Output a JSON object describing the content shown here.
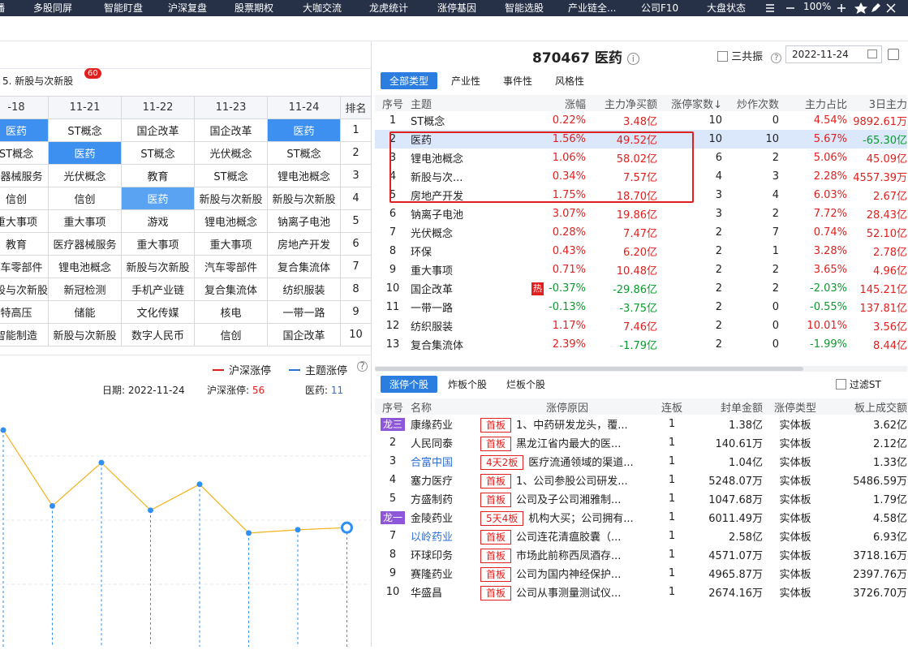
{
  "nav": {
    "items": [
      "播",
      "多股同屏",
      "智能盯盘",
      "沪深复盘",
      "股票期权",
      "大咖交流",
      "龙虎统计",
      "涨停基因",
      "智能选股",
      "产业链全...",
      "公司F10",
      "大盘状态"
    ],
    "zoom": "100%",
    "controls": [
      "menu-icon",
      "minus-icon",
      "plus-icon",
      "star-icon",
      "edit-icon",
      "close-icon"
    ]
  },
  "left": {
    "section_title": "5. 新股与次新股",
    "section_badge": "60",
    "rank_table": {
      "headers": [
        "-18",
        "11-21",
        "11-22",
        "11-23",
        "11-24",
        "排名"
      ],
      "rows": [
        [
          "医药",
          "ST概念",
          "国企改革",
          "国企改革",
          "医药",
          "1"
        ],
        [
          "ST概念",
          "医药",
          "ST概念",
          "光伏概念",
          "ST概念",
          "2"
        ],
        [
          "疗器械服务",
          "光伏概念",
          "教育",
          "ST概念",
          "锂电池概念",
          "3"
        ],
        [
          "信创",
          "信创",
          "医药",
          "新股与次新股",
          "新股与次新股",
          "4"
        ],
        [
          "重大事项",
          "重大事项",
          "游戏",
          "锂电池概念",
          "钠离子电池",
          "5"
        ],
        [
          "教育",
          "医疗器械服务",
          "重大事项",
          "重大事项",
          "房地产开发",
          "6"
        ],
        [
          "汽车零部件",
          "锂电池概念",
          "新股与次新股",
          "汽车零部件",
          "复合集流体",
          "7"
        ],
        [
          "新股与次新股",
          "新冠检测",
          "手机产业链",
          "复合集流体",
          "纺织服装",
          "8"
        ],
        [
          "特高压",
          "储能",
          "文化传媒",
          "核电",
          "一带一路",
          "9"
        ],
        [
          "智能制造",
          "新股与次新股",
          "数字人民币",
          "信创",
          "国企改革",
          "10"
        ]
      ]
    },
    "legend": {
      "series1": "沪深涨停",
      "series2": "主题涨停"
    },
    "info": {
      "date_label": "日期:",
      "date": "2022-11-24",
      "hs_label": "沪深涨停:",
      "hs_value": "56",
      "theme_label": "医药:",
      "theme_value": "11"
    },
    "chart_data": {
      "type": "line",
      "series": [
        {
          "name": "主题涨停",
          "values": [
            20,
            13,
            17,
            12.6,
            15,
            10.5,
            10.8,
            11
          ]
        }
      ],
      "ylim": [
        0,
        23
      ],
      "colors": {
        "line": "#f2b21a",
        "highlight": "#2f8ff5"
      }
    }
  },
  "right": {
    "stock_code": "870467",
    "stock_name": "医药",
    "sanfen_label": "三共振",
    "date_value": "2022-11-24",
    "top_tabs": [
      "全部类型",
      "产业性",
      "事件性",
      "风格性"
    ],
    "top_headers": [
      "序号",
      "主题",
      "涨幅",
      "主力净买额",
      "涨停家数↓",
      "炒作次数",
      "主力占比",
      "3日主力"
    ],
    "top_rows": [
      {
        "no": "1",
        "name": "ST概念",
        "chg": "0.22%",
        "net": "3.48亿",
        "zt": "10",
        "cz": "0",
        "ratio": "4.54%",
        "d3": "9892.61万",
        "sel": false,
        "hot": false
      },
      {
        "no": "2",
        "name": "医药",
        "chg": "1.56%",
        "net": "49.52亿",
        "zt": "10",
        "cz": "10",
        "ratio": "5.67%",
        "d3": "-65.30亿",
        "sel": true,
        "hot": false
      },
      {
        "no": "3",
        "name": "锂电池概念",
        "chg": "1.06%",
        "net": "58.02亿",
        "zt": "6",
        "cz": "2",
        "ratio": "5.06%",
        "d3": "45.09亿",
        "sel": false,
        "hot": false
      },
      {
        "no": "4",
        "name": "新股与次...",
        "chg": "0.34%",
        "net": "7.57亿",
        "zt": "4",
        "cz": "3",
        "ratio": "2.28%",
        "d3": "4557.39万",
        "sel": false,
        "hot": false
      },
      {
        "no": "5",
        "name": "房地产开发",
        "chg": "1.75%",
        "net": "18.70亿",
        "zt": "3",
        "cz": "4",
        "ratio": "6.03%",
        "d3": "2.67亿",
        "sel": false,
        "hot": false
      },
      {
        "no": "6",
        "name": "钠离子电池",
        "chg": "3.07%",
        "net": "19.86亿",
        "zt": "3",
        "cz": "2",
        "ratio": "7.72%",
        "d3": "28.43亿",
        "sel": false,
        "hot": false
      },
      {
        "no": "7",
        "name": "光伏概念",
        "chg": "0.28%",
        "net": "7.47亿",
        "zt": "2",
        "cz": "7",
        "ratio": "0.74%",
        "d3": "52.10亿",
        "sel": false,
        "hot": false
      },
      {
        "no": "8",
        "name": "环保",
        "chg": "0.43%",
        "net": "6.20亿",
        "zt": "2",
        "cz": "1",
        "ratio": "3.28%",
        "d3": "2.78亿",
        "sel": false,
        "hot": false
      },
      {
        "no": "9",
        "name": "重大事项",
        "chg": "0.71%",
        "net": "10.48亿",
        "zt": "2",
        "cz": "2",
        "ratio": "3.65%",
        "d3": "4.96亿",
        "sel": false,
        "hot": false
      },
      {
        "no": "10",
        "name": "国企改革",
        "chg": "-0.37%",
        "net": "-29.86亿",
        "zt": "2",
        "cz": "2",
        "ratio": "-2.03%",
        "d3": "145.21亿",
        "sel": false,
        "hot": true
      },
      {
        "no": "11",
        "name": "一带一路",
        "chg": "-0.13%",
        "net": "-3.75亿",
        "zt": "2",
        "cz": "0",
        "ratio": "-0.55%",
        "d3": "137.81亿",
        "sel": false,
        "hot": false
      },
      {
        "no": "12",
        "name": "纺织服装",
        "chg": "1.17%",
        "net": "7.46亿",
        "zt": "2",
        "cz": "0",
        "ratio": "10.01%",
        "d3": "3.56亿",
        "sel": false,
        "hot": false
      },
      {
        "no": "13",
        "name": "复合集流体",
        "chg": "2.39%",
        "net": "-1.79亿",
        "zt": "2",
        "cz": "0",
        "ratio": "-1.99%",
        "d3": "8.44亿",
        "sel": false,
        "hot": false
      }
    ],
    "hot_label": "热",
    "bottom_tabs": [
      "涨停个股",
      "炸板个股",
      "烂板个股"
    ],
    "filter_st": "过滤ST",
    "bottom_headers": [
      "序号",
      "名称",
      "涨停原因",
      "连板",
      "封单金额",
      "涨停类型",
      "板上成交额"
    ],
    "bottom_rows": [
      {
        "no": "",
        "dragon": "龙三",
        "name": "康缘药业",
        "tag": "首板",
        "reason": "1、中药研发龙头，覆...",
        "lb": "1",
        "fd": "1.38亿",
        "type": "实体板",
        "amt": "3.62亿",
        "blue": false
      },
      {
        "no": "2",
        "dragon": "",
        "name": "人民同泰",
        "tag": "首板",
        "reason": "黑龙江省内最大的医...",
        "lb": "1",
        "fd": "140.61万",
        "type": "实体板",
        "amt": "2.12亿",
        "blue": false
      },
      {
        "no": "3",
        "dragon": "",
        "name": "合富中国",
        "tag": "4天2板",
        "reason": "医疗流通领域的渠道...",
        "lb": "1",
        "fd": "1.04亿",
        "type": "实体板",
        "amt": "1.33亿",
        "blue": true
      },
      {
        "no": "4",
        "dragon": "",
        "name": "塞力医疗",
        "tag": "首板",
        "reason": "1、公司参股公司研发...",
        "lb": "1",
        "fd": "5248.07万",
        "type": "实体板",
        "amt": "5486.59万",
        "blue": false
      },
      {
        "no": "5",
        "dragon": "",
        "name": "方盛制药",
        "tag": "首板",
        "reason": "公司及子公司湘雅制...",
        "lb": "1",
        "fd": "1047.68万",
        "type": "实体板",
        "amt": "1.79亿",
        "blue": false
      },
      {
        "no": "",
        "dragon": "龙一",
        "name": "金陵药业",
        "tag": "5天4板",
        "reason": "机构大买；公司拥有...",
        "lb": "1",
        "fd": "6011.49万",
        "type": "实体板",
        "amt": "4.58亿",
        "blue": false
      },
      {
        "no": "7",
        "dragon": "",
        "name": "以岭药业",
        "tag": "首板",
        "reason": "公司连花清瘟胶囊（...",
        "lb": "1",
        "fd": "2.58亿",
        "type": "实体板",
        "amt": "6.93亿",
        "blue": true
      },
      {
        "no": "8",
        "dragon": "",
        "name": "环球印务",
        "tag": "首板",
        "reason": "市场此前称西凤酒存...",
        "lb": "1",
        "fd": "4571.07万",
        "type": "实体板",
        "amt": "3718.16万",
        "blue": false
      },
      {
        "no": "9",
        "dragon": "",
        "name": "赛隆药业",
        "tag": "首板",
        "reason": "公司为国内神经保护...",
        "lb": "1",
        "fd": "4965.87万",
        "type": "实体板",
        "amt": "2397.76万",
        "blue": false
      },
      {
        "no": "10",
        "dragon": "",
        "name": "华盛昌",
        "tag": "首板",
        "reason": "公司从事测量测试仪...",
        "lb": "1",
        "fd": "2674.16万",
        "type": "实体板",
        "amt": "3726.70万",
        "blue": false
      }
    ]
  }
}
